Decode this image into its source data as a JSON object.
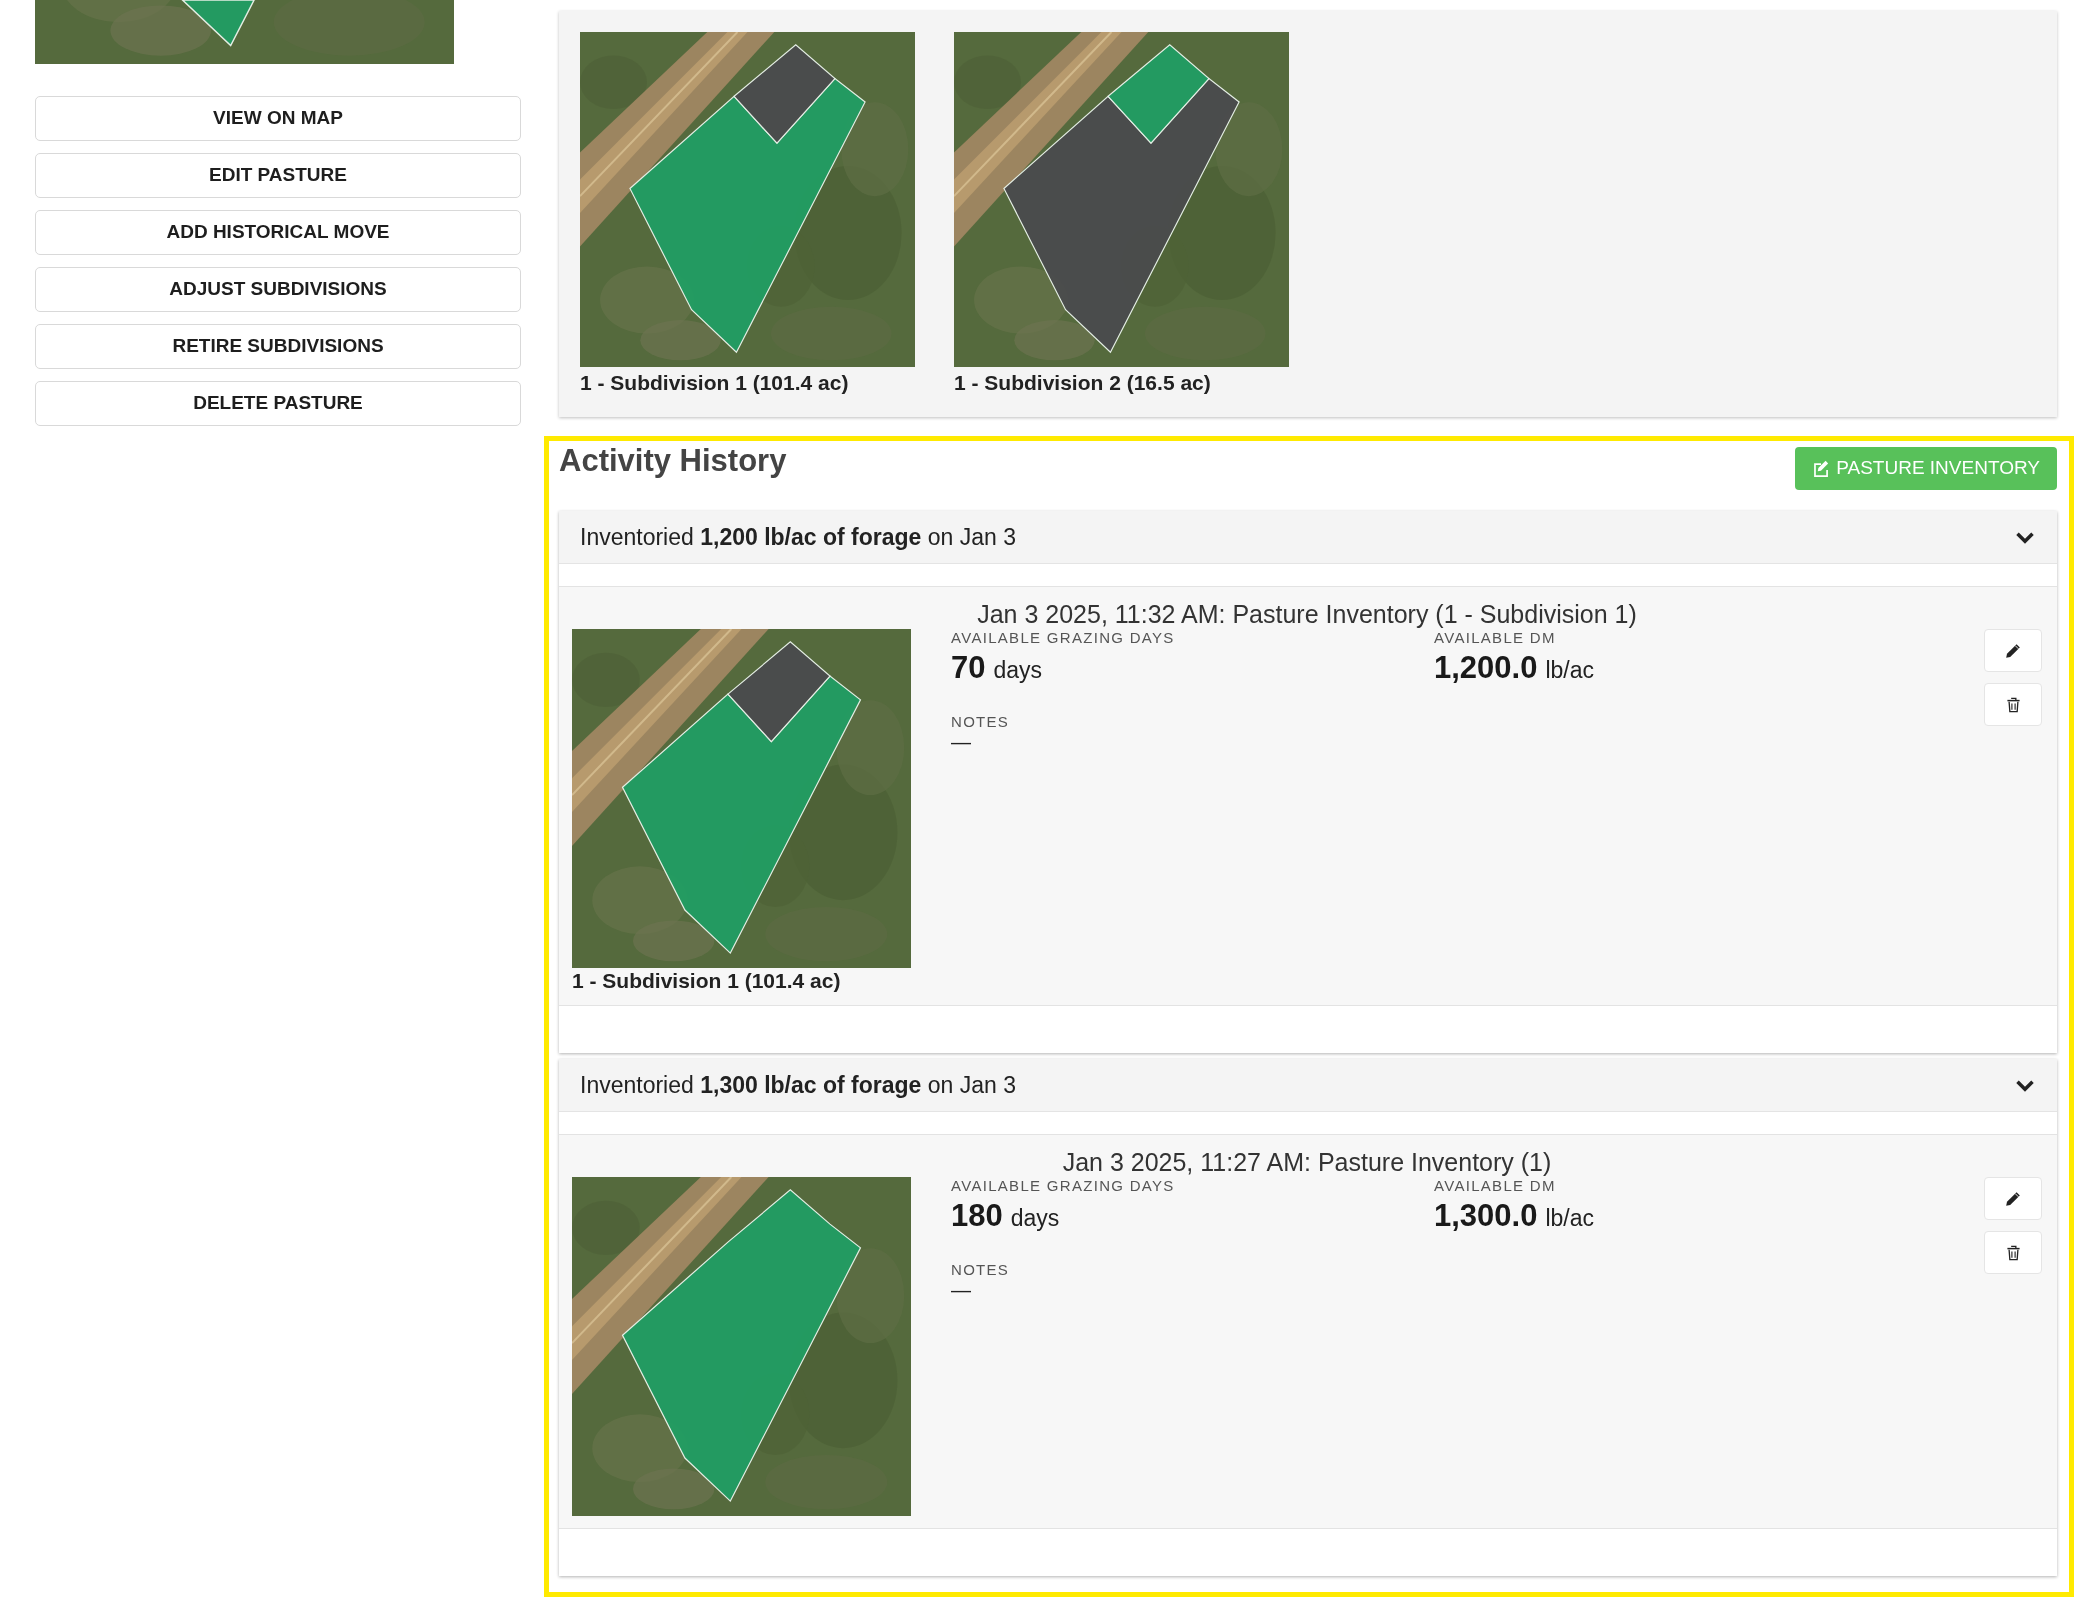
{
  "sidebar": {
    "map": {
      "areas": [
        {
          "kind": "whole",
          "highlighted": true
        }
      ]
    },
    "buttons": [
      "VIEW ON MAP",
      "EDIT PASTURE",
      "ADD HISTORICAL MOVE",
      "ADJUST SUBDIVISIONS",
      "RETIRE SUBDIVISIONS",
      "DELETE PASTURE"
    ]
  },
  "subdivisions": [
    {
      "label": "1 - Subdivision 1 (101.4 ac)",
      "map": {
        "areas": [
          {
            "kind": "main",
            "highlighted": true
          },
          {
            "kind": "corner",
            "highlighted": false
          }
        ]
      }
    },
    {
      "label": "1 - Subdivision 2 (16.5 ac)",
      "map": {
        "areas": [
          {
            "kind": "main",
            "highlighted": false
          },
          {
            "kind": "corner",
            "highlighted": true
          }
        ]
      }
    }
  ],
  "activity_history": {
    "title": "Activity History",
    "highlighted": true,
    "action_button": "PASTURE INVENTORY",
    "entries": [
      {
        "summary": "Inventoried **1,200 lb/ac of forage** on Jan 3",
        "expanded": true,
        "title": "Jan 3 2025, 11:32 AM: Pasture Inventory (1 - Subdivision 1)",
        "map": {
          "areas": [
            {
              "kind": "main",
              "highlighted": true
            },
            {
              "kind": "corner",
              "highlighted": false
            }
          ]
        },
        "map_label": "1 - Subdivision 1 (101.4 ac)",
        "stats": [
          {
            "label": "AVAILABLE GRAZING DAYS",
            "value": "70",
            "unit": "days"
          },
          {
            "label": "AVAILABLE DM",
            "value": "1,200.0",
            "unit": "lb/ac"
          }
        ],
        "notes_label": "NOTES",
        "notes": "—"
      },
      {
        "summary": "Inventoried **1,300 lb/ac of forage** on Jan 3",
        "expanded": true,
        "title": "Jan 3 2025, 11:27 AM: Pasture Inventory (1)",
        "map": {
          "areas": [
            {
              "kind": "whole",
              "highlighted": true
            }
          ]
        },
        "stats": [
          {
            "label": "AVAILABLE GRAZING DAYS",
            "value": "180",
            "unit": "days"
          },
          {
            "label": "AVAILABLE DM",
            "value": "1,300.0",
            "unit": "lb/ac"
          }
        ],
        "notes_label": "NOTES",
        "notes": "—"
      }
    ]
  }
}
